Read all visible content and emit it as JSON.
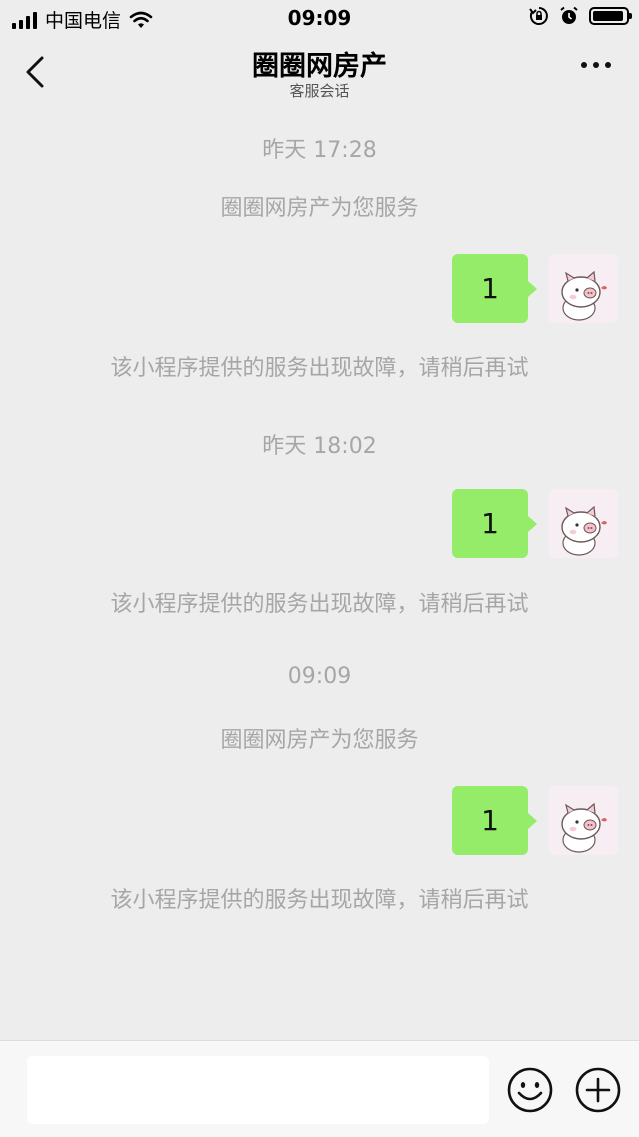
{
  "status_bar": {
    "carrier": "中国电信",
    "time": "09:09",
    "battery_level": 0.9
  },
  "header": {
    "title": "圈圈网房产",
    "subtitle": "客服会话"
  },
  "messages": {
    "group1": {
      "timestamp": "昨天 17:28",
      "service_notice": "圈圈网房产为您服务",
      "user_message": "1",
      "error_notice": "该小程序提供的服务出现故障，请稍后再试"
    },
    "group2": {
      "timestamp": "昨天 18:02",
      "user_message": "1",
      "error_notice": "该小程序提供的服务出现故障，请稍后再试"
    },
    "group3": {
      "timestamp": "09:09",
      "service_notice": "圈圈网房产为您服务",
      "user_message": "1",
      "error_notice": "该小程序提供的服务出现故障，请稍后再试"
    }
  },
  "input_bar": {
    "input_value": "",
    "emoji_icon": "smiley-icon",
    "more_icon": "plus-circle-icon"
  },
  "colors": {
    "background": "#ededed",
    "bubble": "#95ec69",
    "system_text": "#a6a6a6"
  }
}
